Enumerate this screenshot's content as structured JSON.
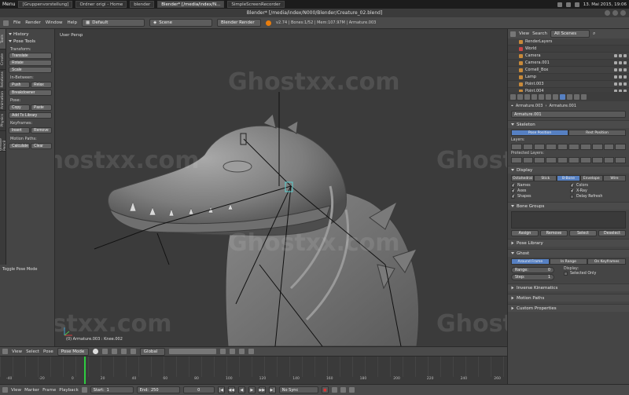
{
  "os": {
    "menu_label": "Menu",
    "tabs": [
      "[Gruppenvorstellung]",
      "Ordner origi - Home",
      "blender",
      "Blender* [/media/index/N...",
      "SimpleScreenRecorder"
    ],
    "clock": "13. Mai 2015, 19:06"
  },
  "window": {
    "title": "Blender* [/media/index/N000/Blender/Creature_02.blend]"
  },
  "info_header": {
    "menus": [
      "File",
      "Render",
      "Window",
      "Help"
    ],
    "layout": "Default",
    "scene": "Scene",
    "engine": "Blender Render",
    "stats": "v2.74 | Bones:1/52 | Mem:107.97M | Armature.003"
  },
  "left_tabs": [
    "Tools",
    "Create",
    "Relations",
    "Animation",
    "Physics",
    "Grease Pencil"
  ],
  "tool_shelf": {
    "panels": [
      {
        "title": "History"
      },
      {
        "title": "Pose Tools"
      }
    ],
    "transform_label": "Transform:",
    "transform_buttons": [
      "Translate",
      "Rotate",
      "Scale"
    ],
    "inbetween_label": "In-Between:",
    "inbetween_row": [
      "Push",
      "Relax"
    ],
    "breakdowner": "Breakdowner",
    "pose_label": "Pose:",
    "pose_row": [
      "Copy",
      "Paste"
    ],
    "add_to_library": "Add To Library",
    "keyframes_label": "Keyframes:",
    "keyframes_row": [
      "Insert",
      "Remove"
    ],
    "motion_paths_label": "Motion Paths:",
    "motion_paths_row": [
      "Calculate",
      "Clear"
    ]
  },
  "toggle_pose_mode": "Toggle Pose Mode",
  "viewport": {
    "label": "User Persp",
    "object_info": "(0) Armature.003 : Knee.002",
    "watermark": "Ghostxx.com"
  },
  "viewport_header": {
    "menus": [
      "View",
      "Select",
      "Pose"
    ],
    "mode": "Pose Mode",
    "orientation": "Global"
  },
  "timeline": {
    "ticks": [
      "-40",
      "-20",
      "0",
      "20",
      "40",
      "60",
      "80",
      "100",
      "120",
      "140",
      "160",
      "180",
      "200",
      "220",
      "240",
      "260"
    ],
    "menus": [
      "View",
      "Marker",
      "Frame",
      "Playback"
    ],
    "start_label": "Start:",
    "start_value": "1",
    "end_label": "End:",
    "end_value": "250",
    "current_frame": "0",
    "sync": "No Sync"
  },
  "outliner": {
    "menus": [
      "View",
      "Search"
    ],
    "filter": "All Scenes",
    "rows": [
      "RenderLayers",
      "World",
      "Camera",
      "Camera.001",
      "Cornell_Box",
      "Lamp",
      "Point.003",
      "Point.004"
    ]
  },
  "properties": {
    "breadcrumb": [
      "Armature.003",
      "Armature.001"
    ],
    "name_field": "Armature.001",
    "skeleton": {
      "title": "Skeleton",
      "segments": [
        "Pose Position",
        "Rest Position"
      ],
      "layers_label": "Layers:",
      "protected_label": "Protected Layers:"
    },
    "display": {
      "title": "Display",
      "segments": [
        "Octahedral",
        "Stick",
        "B-Bone",
        "Envelope",
        "Wire"
      ],
      "checks": [
        {
          "label": "Names",
          "checked": true
        },
        {
          "label": "Colors",
          "checked": true
        },
        {
          "label": "Axes",
          "checked": true
        },
        {
          "label": "X-Ray",
          "checked": true
        },
        {
          "label": "Shapes",
          "checked": true
        },
        {
          "label": "Delay Refresh",
          "checked": false
        }
      ]
    },
    "bone_groups": {
      "title": "Bone Groups",
      "buttons": [
        "Assign",
        "Remove",
        "Select",
        "Deselect"
      ]
    },
    "pose_library": "Pose Library",
    "ghost": {
      "title": "Ghost",
      "segments": [
        "Around Frame",
        "In Range",
        "On Keyframes"
      ],
      "range_label": "Range:",
      "range_value": "0",
      "step_label": "Step:",
      "step_value": "1",
      "display_label": "Display:",
      "selected_only": "Selected Only"
    },
    "inverse_kinematics": "Inverse Kinematics",
    "motion_paths": "Motion Paths",
    "custom_properties": "Custom Properties"
  }
}
